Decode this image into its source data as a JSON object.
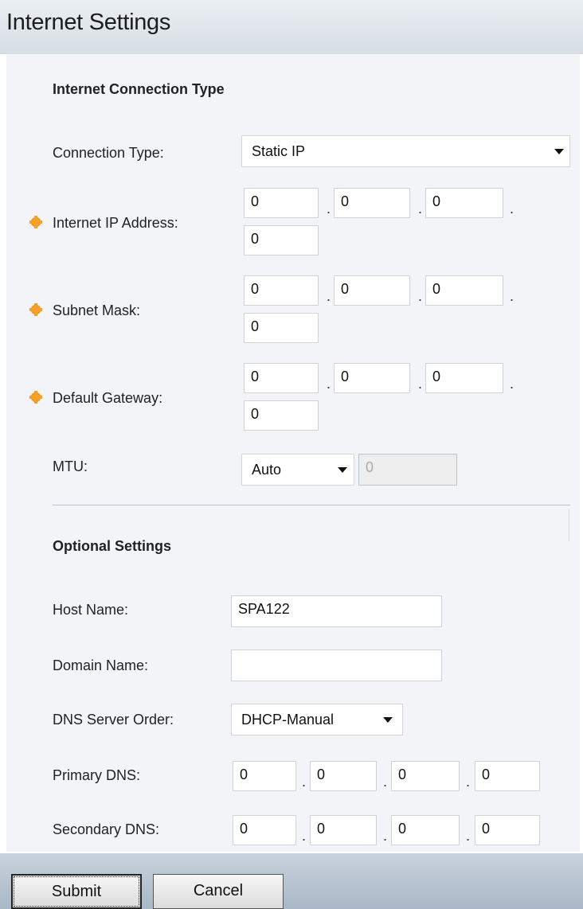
{
  "page": {
    "title": "Internet Settings"
  },
  "connection": {
    "section_title": "Internet Connection Type",
    "type_label": "Connection Type:",
    "type_value": "Static IP",
    "ip_label": "Internet IP Address:",
    "ip": [
      "0",
      "0",
      "0",
      "0"
    ],
    "mask_label": "Subnet Mask:",
    "mask": [
      "0",
      "0",
      "0",
      "0"
    ],
    "gateway_label": "Default Gateway:",
    "gateway": [
      "0",
      "0",
      "0",
      "0"
    ],
    "mtu_label": "MTU:",
    "mtu_mode": "Auto",
    "mtu_value": "0"
  },
  "optional": {
    "section_title": "Optional Settings",
    "host_label": "Host Name:",
    "host_value": "SPA122",
    "domain_label": "Domain Name:",
    "domain_value": "",
    "dns_order_label": "DNS Server Order:",
    "dns_order_value": "DHCP-Manual",
    "primary_dns_label": "Primary DNS:",
    "primary_dns": [
      "0",
      "0",
      "0",
      "0"
    ],
    "secondary_dns_label": "Secondary DNS:",
    "secondary_dns": [
      "0",
      "0",
      "0",
      "0"
    ]
  },
  "actions": {
    "submit": "Submit",
    "cancel": "Cancel"
  },
  "icons": {
    "required_marker": "gear-asterisk-icon",
    "dropdown": "caret-down-icon"
  },
  "colors": {
    "required_marker": "#f39a1a",
    "header_bg": "#dfe5ea",
    "panel_bg": "#f3f4f7",
    "divider": "#b9bde0"
  }
}
